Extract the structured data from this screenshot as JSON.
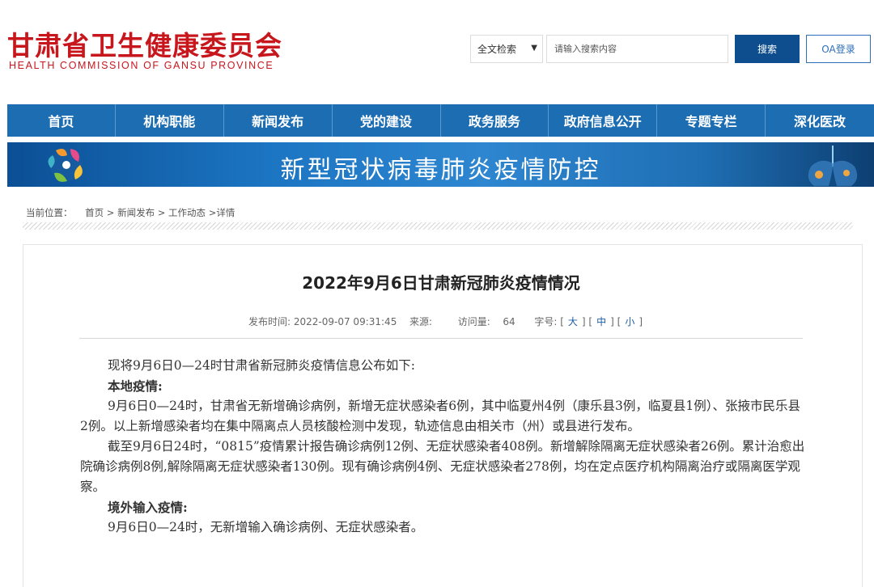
{
  "header": {
    "logo_cn": "甘肃省卫生健康委员会",
    "logo_en": "HEALTH COMMISSION OF GANSU PROVINCE"
  },
  "search": {
    "scope": "全文检索",
    "placeholder": "请输入搜索内容",
    "button": "搜索",
    "oa_button": "OA登录"
  },
  "nav": {
    "items": [
      "首页",
      "机构职能",
      "新闻发布",
      "党的建设",
      "政务服务",
      "政府信息公开",
      "专题专栏",
      "深化医改"
    ]
  },
  "banner": {
    "title": "新型冠状病毒肺炎疫情防控"
  },
  "breadcrumb": {
    "label": "当前位置：",
    "path": "首页 > 新闻发布 > 工作动态 >详情"
  },
  "article": {
    "title": "2022年9月6日甘肃新冠肺炎疫情情况",
    "published_label": "发布时间:",
    "published": "2022-09-07 09:31:45",
    "source_label": "来源:",
    "views_label": "访问量:",
    "views": "64",
    "fontsize_label": "字号:",
    "size_large": "大",
    "size_medium": "中",
    "size_small": "小",
    "intro": "现将9月6日0—24时甘肃省新冠肺炎疫情信息公布如下:",
    "local_heading": "本地疫情:",
    "local_p1": "9月6日0—24时，甘肃省无新增确诊病例，新增无症状感染者6例，其中临夏州4例（康乐县3例，临夏县1例）、张掖市民乐县2例。以上新增感染者均在集中隔离点人员核酸检测中发现，轨迹信息由相关市（州）或县进行发布。",
    "local_p2": "截至9月6日24时，“0815”疫情累计报告确诊病例12例、无症状感染者408例。新增解除隔离无症状感染者26例。累计治愈出院确诊病例8例,解除隔离无症状感染者130例。现有确诊病例4例、无症状感染者278例，均在定点医疗机构隔离治疗或隔离医学观察。",
    "import_heading": "境外输入疫情:",
    "import_p1": "9月6日0—24时，无新增输入确诊病例、无症状感染者。"
  },
  "colors": {
    "brand_red": "#c8161d",
    "nav_blue": "#1d6db3",
    "button_blue": "#0e4e8f"
  }
}
